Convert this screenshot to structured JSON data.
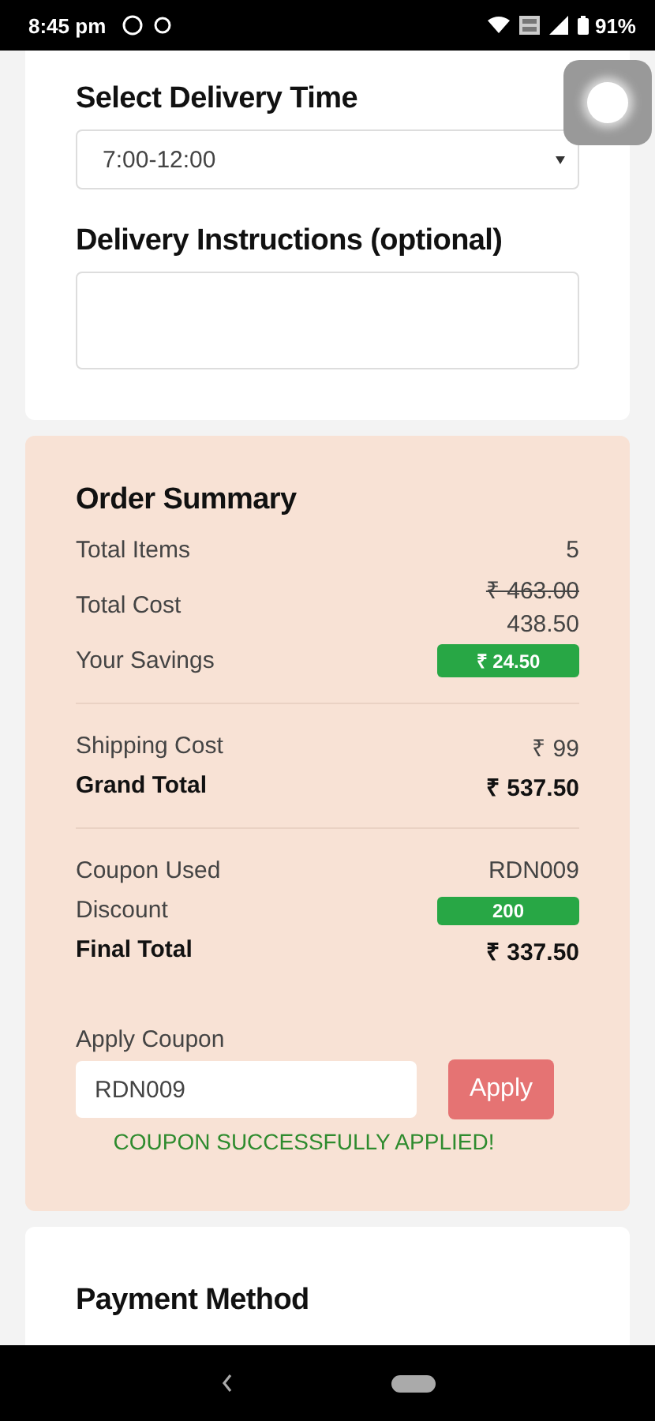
{
  "status_bar": {
    "time": "8:45 pm",
    "battery": "91%"
  },
  "delivery": {
    "time_label": "Select Delivery Time",
    "time_value": "7:00-12:00",
    "instructions_label": "Delivery Instructions (optional)"
  },
  "summary": {
    "title": "Order Summary",
    "groups": [
      [
        {
          "kind": "text",
          "label": "Total Items",
          "value": "5"
        },
        {
          "kind": "price_change",
          "label": "Total Cost",
          "old": "₹ 463.00",
          "value": "438.50"
        },
        {
          "kind": "badge",
          "label": "Your Savings",
          "value": "₹ 24.50"
        }
      ],
      [
        {
          "kind": "text",
          "label": "Shipping Cost",
          "value": "₹ 99"
        },
        {
          "kind": "total",
          "label": "Grand Total",
          "value": "₹ 537.50"
        }
      ],
      [
        {
          "kind": "text",
          "label": "Coupon Used",
          "value": "RDN009"
        },
        {
          "kind": "badge",
          "label": "Discount",
          "value": "200"
        },
        {
          "kind": "total",
          "label": "Final Total",
          "value": "₹ 337.50"
        }
      ]
    ],
    "coupon": {
      "label": "Apply Coupon",
      "value": "RDN009",
      "button": "Apply",
      "message": "COUPON SUCCESSFULLY APPLIED!"
    }
  },
  "payment": {
    "title": "Payment Method"
  }
}
